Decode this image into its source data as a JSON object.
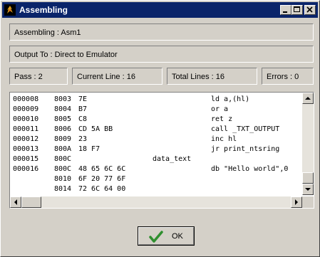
{
  "window": {
    "title": "Assembling",
    "icon": "app-flame-icon"
  },
  "info": {
    "assembling": "Assembling : Asm1",
    "output": "Output To : Direct to Emulator"
  },
  "status": {
    "pass": "Pass : 2",
    "current_line": "Current Line : 16",
    "total_lines": "Total Lines : 16",
    "errors": "Errors : 0"
  },
  "listing": [
    {
      "line": "000008",
      "addr": "8003",
      "bytes": "7E",
      "label": "",
      "code": "ld a,(hl)"
    },
    {
      "line": "000009",
      "addr": "8004",
      "bytes": "B7",
      "label": "",
      "code": "or a"
    },
    {
      "line": "000010",
      "addr": "8005",
      "bytes": "C8",
      "label": "",
      "code": "ret z"
    },
    {
      "line": "000011",
      "addr": "8006",
      "bytes": "CD 5A BB",
      "label": "",
      "code": "call _TXT_OUTPUT"
    },
    {
      "line": "000012",
      "addr": "8009",
      "bytes": "23",
      "label": "",
      "code": "inc hl"
    },
    {
      "line": "000013",
      "addr": "800A",
      "bytes": "18 F7",
      "label": "",
      "code": "jr print_ntsring"
    },
    {
      "line": "000015",
      "addr": "800C",
      "bytes": "",
      "label": "data_text",
      "code": ""
    },
    {
      "line": "000016",
      "addr": "800C",
      "bytes": "48 65 6C 6C",
      "label": "",
      "code": "db \"Hello world\",0"
    },
    {
      "line": "",
      "addr": "8010",
      "bytes": "6F 20 77 6F",
      "label": "",
      "code": ""
    },
    {
      "line": "",
      "addr": "8014",
      "bytes": "72 6C 64 00",
      "label": "",
      "code": ""
    }
  ],
  "ok_button": {
    "label": "OK",
    "icon": "checkmark-icon"
  },
  "colors": {
    "titlebar": "#0a246a",
    "face": "#d4d0c8",
    "check": "#2f8f2f"
  }
}
